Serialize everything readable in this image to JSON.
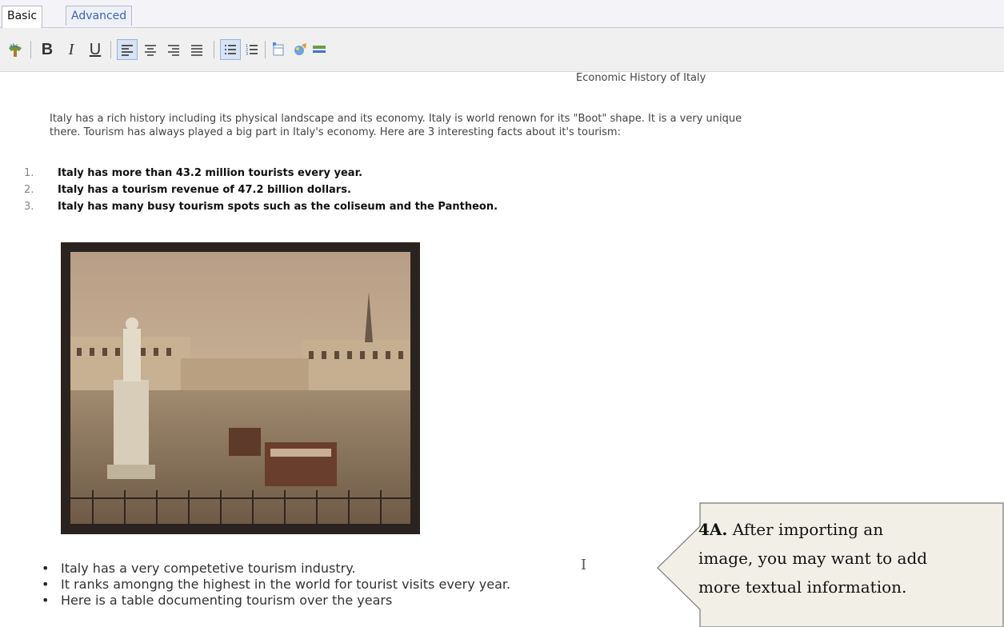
{
  "tabs": [
    {
      "label": "Basic",
      "active": true
    },
    {
      "label": "Advanced",
      "active": false
    }
  ],
  "toolbar": {
    "tools": [
      "spellcheck-icon",
      "bold-icon",
      "italic-icon",
      "underline-icon",
      "align-left-icon",
      "align-center-icon",
      "align-right-icon",
      "align-justify-icon",
      "unordered-list-icon",
      "ordered-list-icon",
      "insert-table-icon",
      "insert-image-icon",
      "insert-line-icon"
    ],
    "bold_label": "B",
    "italic_label": "I",
    "underline_label": "U",
    "active_color": "#d8e3f3"
  },
  "document": {
    "title": "Economic History of Italy",
    "intro_line1": "Italy has a rich history including its physical landscape and its economy. Italy is world renown for its \"Boot\" shape. It is a very unique",
    "intro_line2": "there. Tourism has always played a big part in Italy's economy. Here are 3 interesting facts about it's tourism:",
    "ordered_list": [
      {
        "num": "1.",
        "text": "Italy has more than 43.2 million tourists every year."
      },
      {
        "num": "2.",
        "text": "Italy has a  tourism revenue of 47.2 billion dollars."
      },
      {
        "num": "3.",
        "text": "Italy has many busy tourism spots such as the coliseum and the Pantheon."
      }
    ],
    "image_alt": "vintage-photo-of-italian-piazza-with-statue-and-trams",
    "bullet_list": [
      "Italy has a very competetive tourism industry.",
      "It ranks amongng the highest in the world for tourist visits every year.",
      "Here is a table documenting tourism over the years"
    ]
  },
  "callout": {
    "step": "4A.",
    "line1": " After importing an",
    "line2": "image, you may want to add",
    "line3": "more textual information.",
    "fill_color": "#f1efe6"
  }
}
